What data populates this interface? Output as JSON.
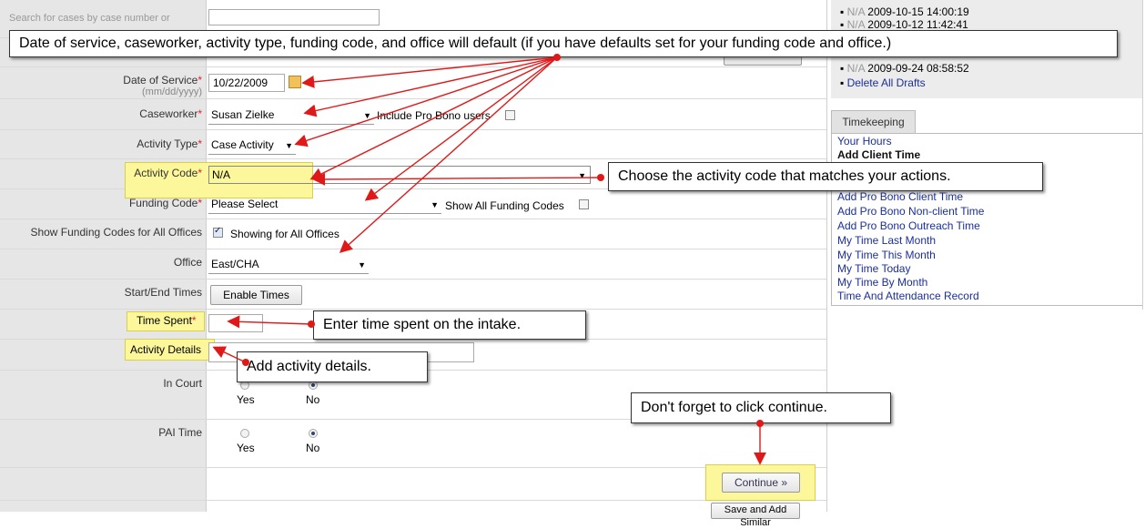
{
  "search": {
    "placeholder_line1": "Search for cases by case number or"
  },
  "form": {
    "date_of_service": {
      "label": "Date of Service",
      "format_hint": "(mm/dd/yyyy)",
      "value": "10/22/2009"
    },
    "caseworker": {
      "label": "Caseworker",
      "value": "Susan Zielke",
      "pro_bono_label": "Include Pro Bono users"
    },
    "activity_type": {
      "label": "Activity Type",
      "value": "Case Activity"
    },
    "activity_code": {
      "label": "Activity Code",
      "value": "N/A"
    },
    "funding_code": {
      "label": "Funding Code",
      "value": "Please Select",
      "show_all_label": "Show All Funding Codes"
    },
    "show_all_offices": {
      "label": "Show Funding Codes for All Offices",
      "checkbox_label": "Showing for All Offices"
    },
    "office": {
      "label": "Office",
      "value": "East/CHA"
    },
    "start_end": {
      "label": "Start/End Times",
      "button": "Enable Times"
    },
    "time_spent": {
      "label": "Time Spent"
    },
    "activity_details": {
      "label": "Activity Details"
    },
    "in_court": {
      "label": "In Court",
      "yes": "Yes",
      "no": "No"
    },
    "pai_time": {
      "label": "PAI Time",
      "yes": "Yes",
      "no": "No"
    },
    "required_mark": "*",
    "continue_button": "Continue »",
    "save_similar_button": "Save and Add Similar"
  },
  "sidebar": {
    "drafts": [
      {
        "code": "N/A",
        "timestamp": "2009-10-15 14:00:19"
      },
      {
        "code": "N/A",
        "timestamp": "2009-10-12 11:42:41"
      },
      {
        "code": "N/A",
        "timestamp": "2009-09-24 08:58:52"
      }
    ],
    "delete_drafts": "Delete All Drafts",
    "tab": "Timekeeping",
    "links": [
      "Your Hours",
      "Add Client Time",
      "Add Pro Bono Client Time",
      "Add Pro Bono Non-client Time",
      "Add Pro Bono Outreach Time",
      "My Time Last Month",
      "My Time This Month",
      "My Time Today",
      "My Time By Month",
      "Time And Attendance Record"
    ]
  },
  "callouts": {
    "defaults": "Date of service, caseworker, activity type, funding code, and office will default (if you have defaults set for your funding code and office.)",
    "activity_code": "Choose the activity code that matches your actions.",
    "time_spent": "Enter time spent on the intake.",
    "details": "Add activity details.",
    "continue": "Don't forget to click continue."
  },
  "colors": {
    "link": "#1a2f9c",
    "highlight": "#fbf79a",
    "arrow": "#e01818",
    "required": "#dd2233"
  }
}
